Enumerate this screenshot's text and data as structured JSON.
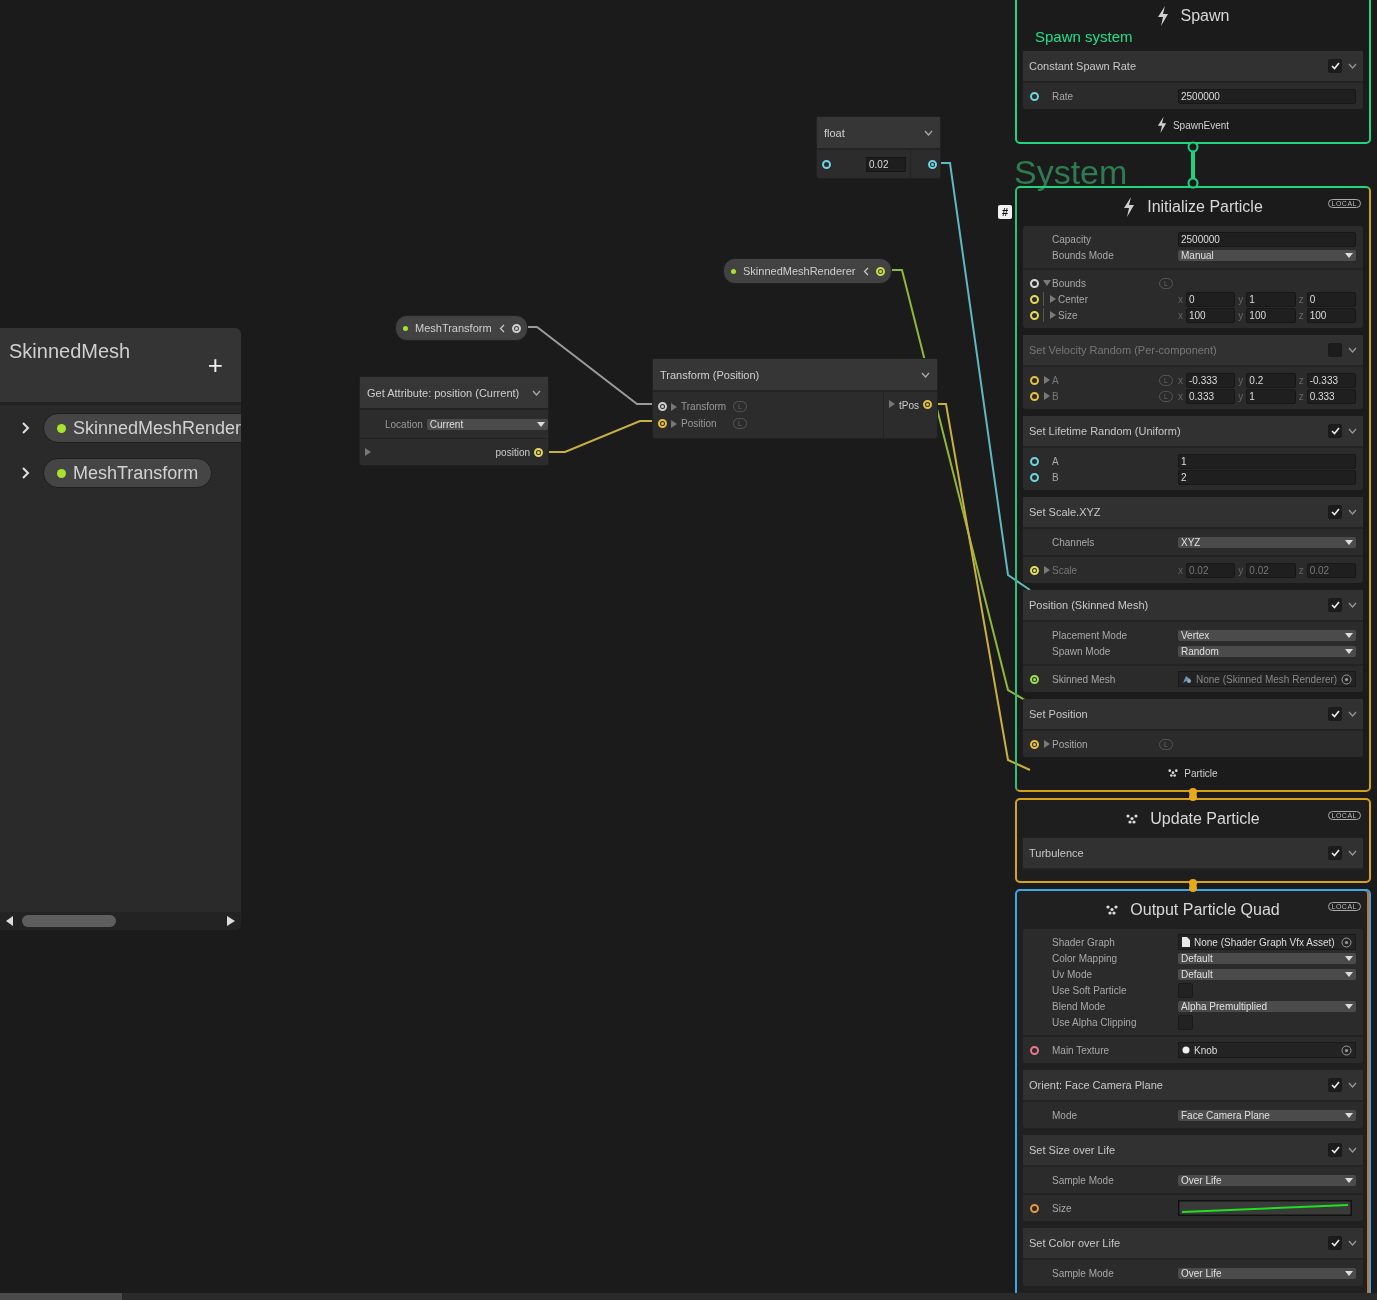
{
  "blackboard": {
    "title": "SkinnedMesh",
    "add": "+",
    "properties": [
      {
        "label": "SkinnedMeshRender",
        "expanded": false,
        "color": "#a6e22e"
      },
      {
        "label": "MeshTransform",
        "expanded": false,
        "color": "#a6e22e"
      }
    ]
  },
  "nodes": [
    {
      "kind": "float",
      "title": "float",
      "color": "#6fd3e0",
      "value": "0.02"
    },
    {
      "kind": "property",
      "label": "SkinnedMeshRenderer",
      "color": "#a6e22e"
    },
    {
      "kind": "property",
      "label": "MeshTransform",
      "color": "#a6e22e"
    },
    {
      "kind": "get_attribute",
      "title": "Get Attribute: position (Current)",
      "settings": [
        {
          "label": "Location",
          "value": "Current"
        }
      ],
      "output": {
        "label": "position",
        "color": "#e6d85a"
      }
    },
    {
      "kind": "operator",
      "title": "Transform (Position)",
      "inputs": [
        {
          "label": "Transform",
          "color": "#cfcfcf",
          "connected": true,
          "space": "L"
        },
        {
          "label": "Position",
          "color": "#e6c040",
          "connected": true,
          "space": "L"
        }
      ],
      "output": {
        "label": "tPos",
        "color": "#e6c040"
      }
    }
  ],
  "system_label": "System",
  "system_marker": "#",
  "contexts": [
    {
      "kind": "spawn",
      "title": "Spawn",
      "subtitle": "Spawn system",
      "blocks": [
        {
          "title": "Constant Spawn Rate",
          "enabled": true,
          "sections": [
            [
              {
                "kind": "field",
                "label": "Rate",
                "color": "#6fd3e0",
                "connected": false,
                "value": "2500000"
              }
            ]
          ]
        }
      ],
      "footer": "SpawnEvent"
    },
    {
      "kind": "initialize",
      "title": "Initialize Particle",
      "badge": "LOCAL",
      "blocks": [
        {
          "sections": [
            [
              {
                "kind": "field",
                "label": "Capacity",
                "value": "2500000"
              },
              {
                "kind": "dropdown",
                "label": "Bounds Mode",
                "value": "Manual"
              }
            ],
            [
              {
                "kind": "group",
                "label": "Bounds",
                "color": "#d8d8d8",
                "connected": false,
                "expanded": true,
                "space": "L",
                "children": [
                  {
                    "kind": "vector",
                    "label": "Center",
                    "color": "#e6d85a",
                    "connected": false,
                    "expanded": false,
                    "components": [
                      {
                        "axis": "x",
                        "value": "0"
                      },
                      {
                        "axis": "y",
                        "value": "1"
                      },
                      {
                        "axis": "z",
                        "value": "0"
                      }
                    ]
                  },
                  {
                    "kind": "vector",
                    "label": "Size",
                    "color": "#e6d85a",
                    "connected": false,
                    "expanded": false,
                    "components": [
                      {
                        "axis": "x",
                        "value": "100"
                      },
                      {
                        "axis": "y",
                        "value": "100"
                      },
                      {
                        "axis": "z",
                        "value": "100"
                      }
                    ]
                  }
                ]
              }
            ]
          ]
        },
        {
          "title": "Set Velocity Random (Per-component)",
          "enabled": false,
          "sections": [
            [
              {
                "kind": "vector",
                "label": "A",
                "color": "#e6c040",
                "connected": false,
                "expanded": false,
                "space": "L",
                "components": [
                  {
                    "axis": "x",
                    "value": "-0.333"
                  },
                  {
                    "axis": "y",
                    "value": "0.2"
                  },
                  {
                    "axis": "z",
                    "value": "-0.333"
                  }
                ]
              },
              {
                "kind": "vector",
                "label": "B",
                "color": "#e6c040",
                "connected": false,
                "expanded": false,
                "space": "L",
                "components": [
                  {
                    "axis": "x",
                    "value": "0.333"
                  },
                  {
                    "axis": "y",
                    "value": "1"
                  },
                  {
                    "axis": "z",
                    "value": "0.333"
                  }
                ]
              }
            ]
          ]
        },
        {
          "title": "Set Lifetime Random (Uniform)",
          "enabled": true,
          "sections": [
            [
              {
                "kind": "field",
                "label": "A",
                "color": "#6fd3e0",
                "connected": false,
                "value": "1"
              },
              {
                "kind": "field",
                "label": "B",
                "color": "#6fd3e0",
                "connected": false,
                "value": "2"
              }
            ]
          ]
        },
        {
          "title": "Set Scale.XYZ",
          "enabled": true,
          "sections": [
            [
              {
                "kind": "dropdown",
                "label": "Channels",
                "value": "XYZ"
              }
            ],
            [
              {
                "kind": "vector",
                "label": "Scale",
                "color": "#e6e05a",
                "connected": true,
                "expanded": false,
                "components": [
                  {
                    "axis": "x",
                    "value": "0.02"
                  },
                  {
                    "axis": "y",
                    "value": "0.02"
                  },
                  {
                    "axis": "z",
                    "value": "0.02"
                  }
                ]
              }
            ]
          ]
        },
        {
          "title": "Position (Skinned Mesh)",
          "enabled": true,
          "sections": [
            [
              {
                "kind": "dropdown",
                "label": "Placement Mode",
                "value": "Vertex"
              },
              {
                "kind": "dropdown",
                "label": "Spawn Mode",
                "value": "Random"
              }
            ],
            [
              {
                "kind": "mesh",
                "label": "Skinned Mesh",
                "color": "#9be04a",
                "connected": true,
                "value": "None (Skinned Mesh Renderer)"
              }
            ]
          ]
        },
        {
          "title": "Set Position",
          "enabled": true,
          "sections": [
            [
              {
                "kind": "group",
                "label": "Position",
                "color": "#e6c040",
                "connected": true,
                "expanded": false,
                "space": "L"
              }
            ]
          ]
        }
      ],
      "footer": "Particle"
    },
    {
      "kind": "update",
      "title": "Update Particle",
      "badge": "LOCAL",
      "blocks": [
        {
          "title": "Turbulence",
          "enabled": true
        }
      ]
    },
    {
      "kind": "output",
      "title": "Output Particle Quad",
      "badge": "LOCAL",
      "blocks": [
        {
          "sections": [
            [
              {
                "kind": "shader",
                "label": "Shader Graph",
                "value": "None (Shader Graph Vfx Asset)"
              },
              {
                "kind": "dropdown",
                "label": "Color Mapping",
                "value": "Default"
              },
              {
                "kind": "dropdown",
                "label": "Uv Mode",
                "value": "Default"
              },
              {
                "kind": "checkbox",
                "label": "Use Soft Particle",
                "checked": false
              },
              {
                "kind": "dropdown",
                "label": "Blend Mode",
                "value": "Alpha Premultiplied"
              },
              {
                "kind": "checkbox",
                "label": "Use Alpha Clipping",
                "checked": false
              }
            ],
            [
              {
                "kind": "texture",
                "label": "Main Texture",
                "color": "#e87a8a",
                "connected": false,
                "value": "Knob"
              }
            ]
          ]
        },
        {
          "title": "Orient: Face Camera Plane",
          "enabled": true,
          "sections": [
            [
              {
                "kind": "dropdown",
                "label": "Mode",
                "value": "Face Camera Plane"
              }
            ]
          ]
        },
        {
          "title": "Set Size over Life",
          "enabled": true,
          "sections": [
            [
              {
                "kind": "dropdown",
                "label": "Sample Mode",
                "value": "Over Life"
              }
            ],
            [
              {
                "kind": "curve",
                "label": "Size",
                "color": "#e8963a",
                "connected": false
              }
            ]
          ]
        },
        {
          "title": "Set Color over Life",
          "enabled": true,
          "sections": [
            [
              {
                "kind": "dropdown",
                "label": "Sample Mode",
                "value": "Over Life"
              }
            ]
          ]
        }
      ]
    }
  ]
}
